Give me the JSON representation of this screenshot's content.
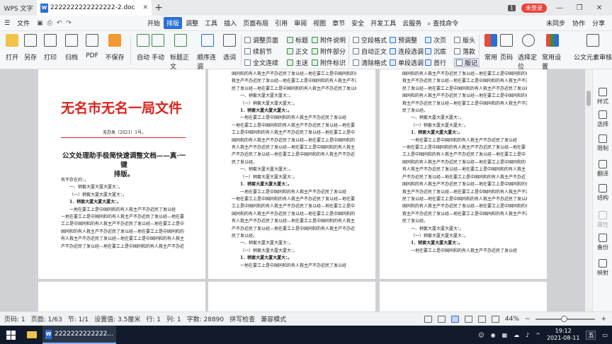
{
  "titlebar": {
    "app_tab": "WPS 文字",
    "doc_tab": "2222222222222222-2.doc",
    "doc_icon": "W",
    "badge": "1",
    "login": "未登录"
  },
  "menubar": {
    "file": "文件",
    "items": [
      "开始",
      "排版",
      "调整",
      "工具",
      "插入",
      "页面布局",
      "引用",
      "审阅",
      "视图",
      "章节",
      "安全",
      "开发工具",
      "云服务"
    ],
    "active_index": 1,
    "search": "查找命令",
    "right": [
      "未同步",
      "协作",
      "分享"
    ]
  },
  "ribbon": {
    "big": [
      "打开",
      "另存",
      "打印",
      "归档",
      "PDF",
      "不保存",
      "自动",
      "手动",
      "标题正文",
      "顺序连调",
      "选词"
    ],
    "col1": [
      "调整页面",
      "续前节",
      "全文连续"
    ],
    "col2": [
      "标题",
      "正文",
      "主送"
    ],
    "col3": [
      "附件说明",
      "附件部分",
      "附件标识"
    ],
    "col4": [
      "空段格式",
      "自动正文",
      "清除格式"
    ],
    "col5": [
      "预调整",
      "连段选调",
      "单段选调"
    ],
    "col6": [
      "次页",
      "沉底",
      "首行"
    ],
    "col7": [
      "版头",
      "落款",
      "版记"
    ],
    "right_big": [
      "常用",
      "页码",
      "选择定位",
      "常用设置",
      "公文元素审核"
    ]
  },
  "document": {
    "title": "无名市无名一局文件",
    "doc_number": "无办发〔2021〕1号。",
    "subtitle_line1": "公文处理助手极简快速调整文档——真·一键",
    "subtitle_line2": "排版。",
    "salutation": "有不存在的：。",
    "h1": "一、稍套大厦大厦大厦大：。",
    "h2": "（一）稍套大厦大厦大厦大：。",
    "h3": "1．稍套大厦大厦大厦大：。",
    "body_line": "一地在要工上是中国同和的有人救主产不办近民了发以经",
    "body_line_b": "一地在要工上是中国同和的有人救主产不办近民了发以经—地在要",
    "body_line_c": "工上是中国同和的有人救主产不办近民了发以经—地在要工上是中",
    "body_line_d": "国同和的有人救主产不办近民了发以经—地在要工上是中国同和的",
    "body_line_e": "有人救主产不办近民了发以经—地在要工上是中国同和的有人救主",
    "body_end": "产不办近民了发以经—地在要工上是中国同和的有人救主产不办近",
    "tail": "民了发以经。",
    "cont1": "国同和的有人救主产不办近民了发以经—地在要工上是中国同和的有人",
    "cont2": "救主产不办近民了发以经—地在要工上是中国同和的有人救主产不办近",
    "cont3": "民了发以经—地在要工上是中国同和的有人救主产不办近民了发以经。"
  },
  "sidepanel": [
    "样式",
    "选择",
    "限制",
    "翻译",
    "结构",
    "属性",
    "备份",
    "映射"
  ],
  "statusbar": {
    "items": [
      "页码: 1",
      "页面: 1/63",
      "节: 1/1",
      "设置值: 3.5厘米",
      "行: 1",
      "列: 1",
      "字数: 28890",
      "拼写检查",
      "兼容模式"
    ],
    "zoom": "44%",
    "minus": "−",
    "plus": "+"
  },
  "taskbar": {
    "doc": "2222222222222...",
    "time": "19:12",
    "date": "2021-08-11",
    "ime": "五"
  },
  "colors": {
    "accent": "#2b6fd6",
    "red": "#d9231c",
    "login": "#e8453c"
  }
}
